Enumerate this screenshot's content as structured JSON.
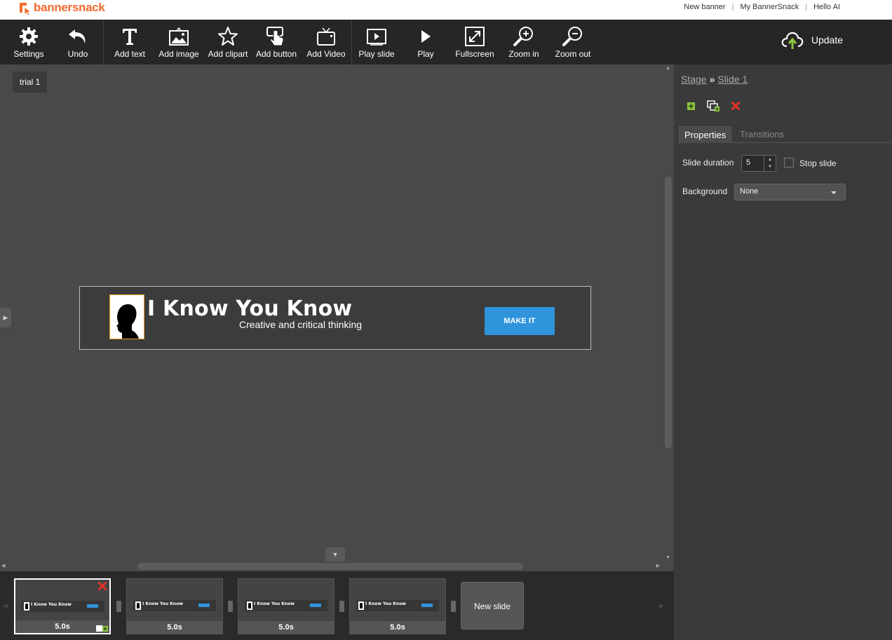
{
  "app": {
    "logo_text": "bannersnack"
  },
  "header": {
    "links": [
      "New banner",
      "My BannerSnack",
      "Hello AI"
    ]
  },
  "toolbar": {
    "settings": "Settings",
    "undo": "Undo",
    "add_text": "Add text",
    "add_image": "Add image",
    "add_clipart": "Add clipart",
    "add_button": "Add button",
    "add_video": "Add Video",
    "play_slide": "Play slide",
    "play": "Play",
    "fullscreen": "Fullscreen",
    "zoom_in": "Zoom in",
    "zoom_out": "Zoom out",
    "update": "Update"
  },
  "canvas": {
    "tag": "trial 1",
    "banner": {
      "title": "I Know You Know",
      "subtitle": "Creative and critical thinking",
      "button_label": "MAKE IT"
    }
  },
  "panel": {
    "breadcrumb": {
      "stage": "Stage",
      "separator": "»",
      "slide": "Slide 1"
    },
    "tabs": {
      "properties": "Properties",
      "transitions": "Transitions"
    },
    "slide_duration_label": "Slide duration",
    "slide_duration_value": "5",
    "stop_slide_label": "Stop slide",
    "background_label": "Background",
    "background_value": "None"
  },
  "slides": {
    "items": [
      {
        "mini_title": "I Know You Know",
        "duration": "5.0s"
      },
      {
        "mini_title": "I Know You Know",
        "duration": "5.0s"
      },
      {
        "mini_title": "I Know You Know",
        "duration": "5.0s"
      },
      {
        "mini_title": "I Know You Know",
        "duration": "5.0s"
      }
    ],
    "new_slide_label": "New slide"
  },
  "colors": {
    "brand_orange": "#f26a2e",
    "toolbar_bg": "#262626",
    "canvas_bg": "#494949",
    "button_blue": "#2f94db",
    "add_green": "#8dc63f",
    "delete_red": "#e53323"
  }
}
